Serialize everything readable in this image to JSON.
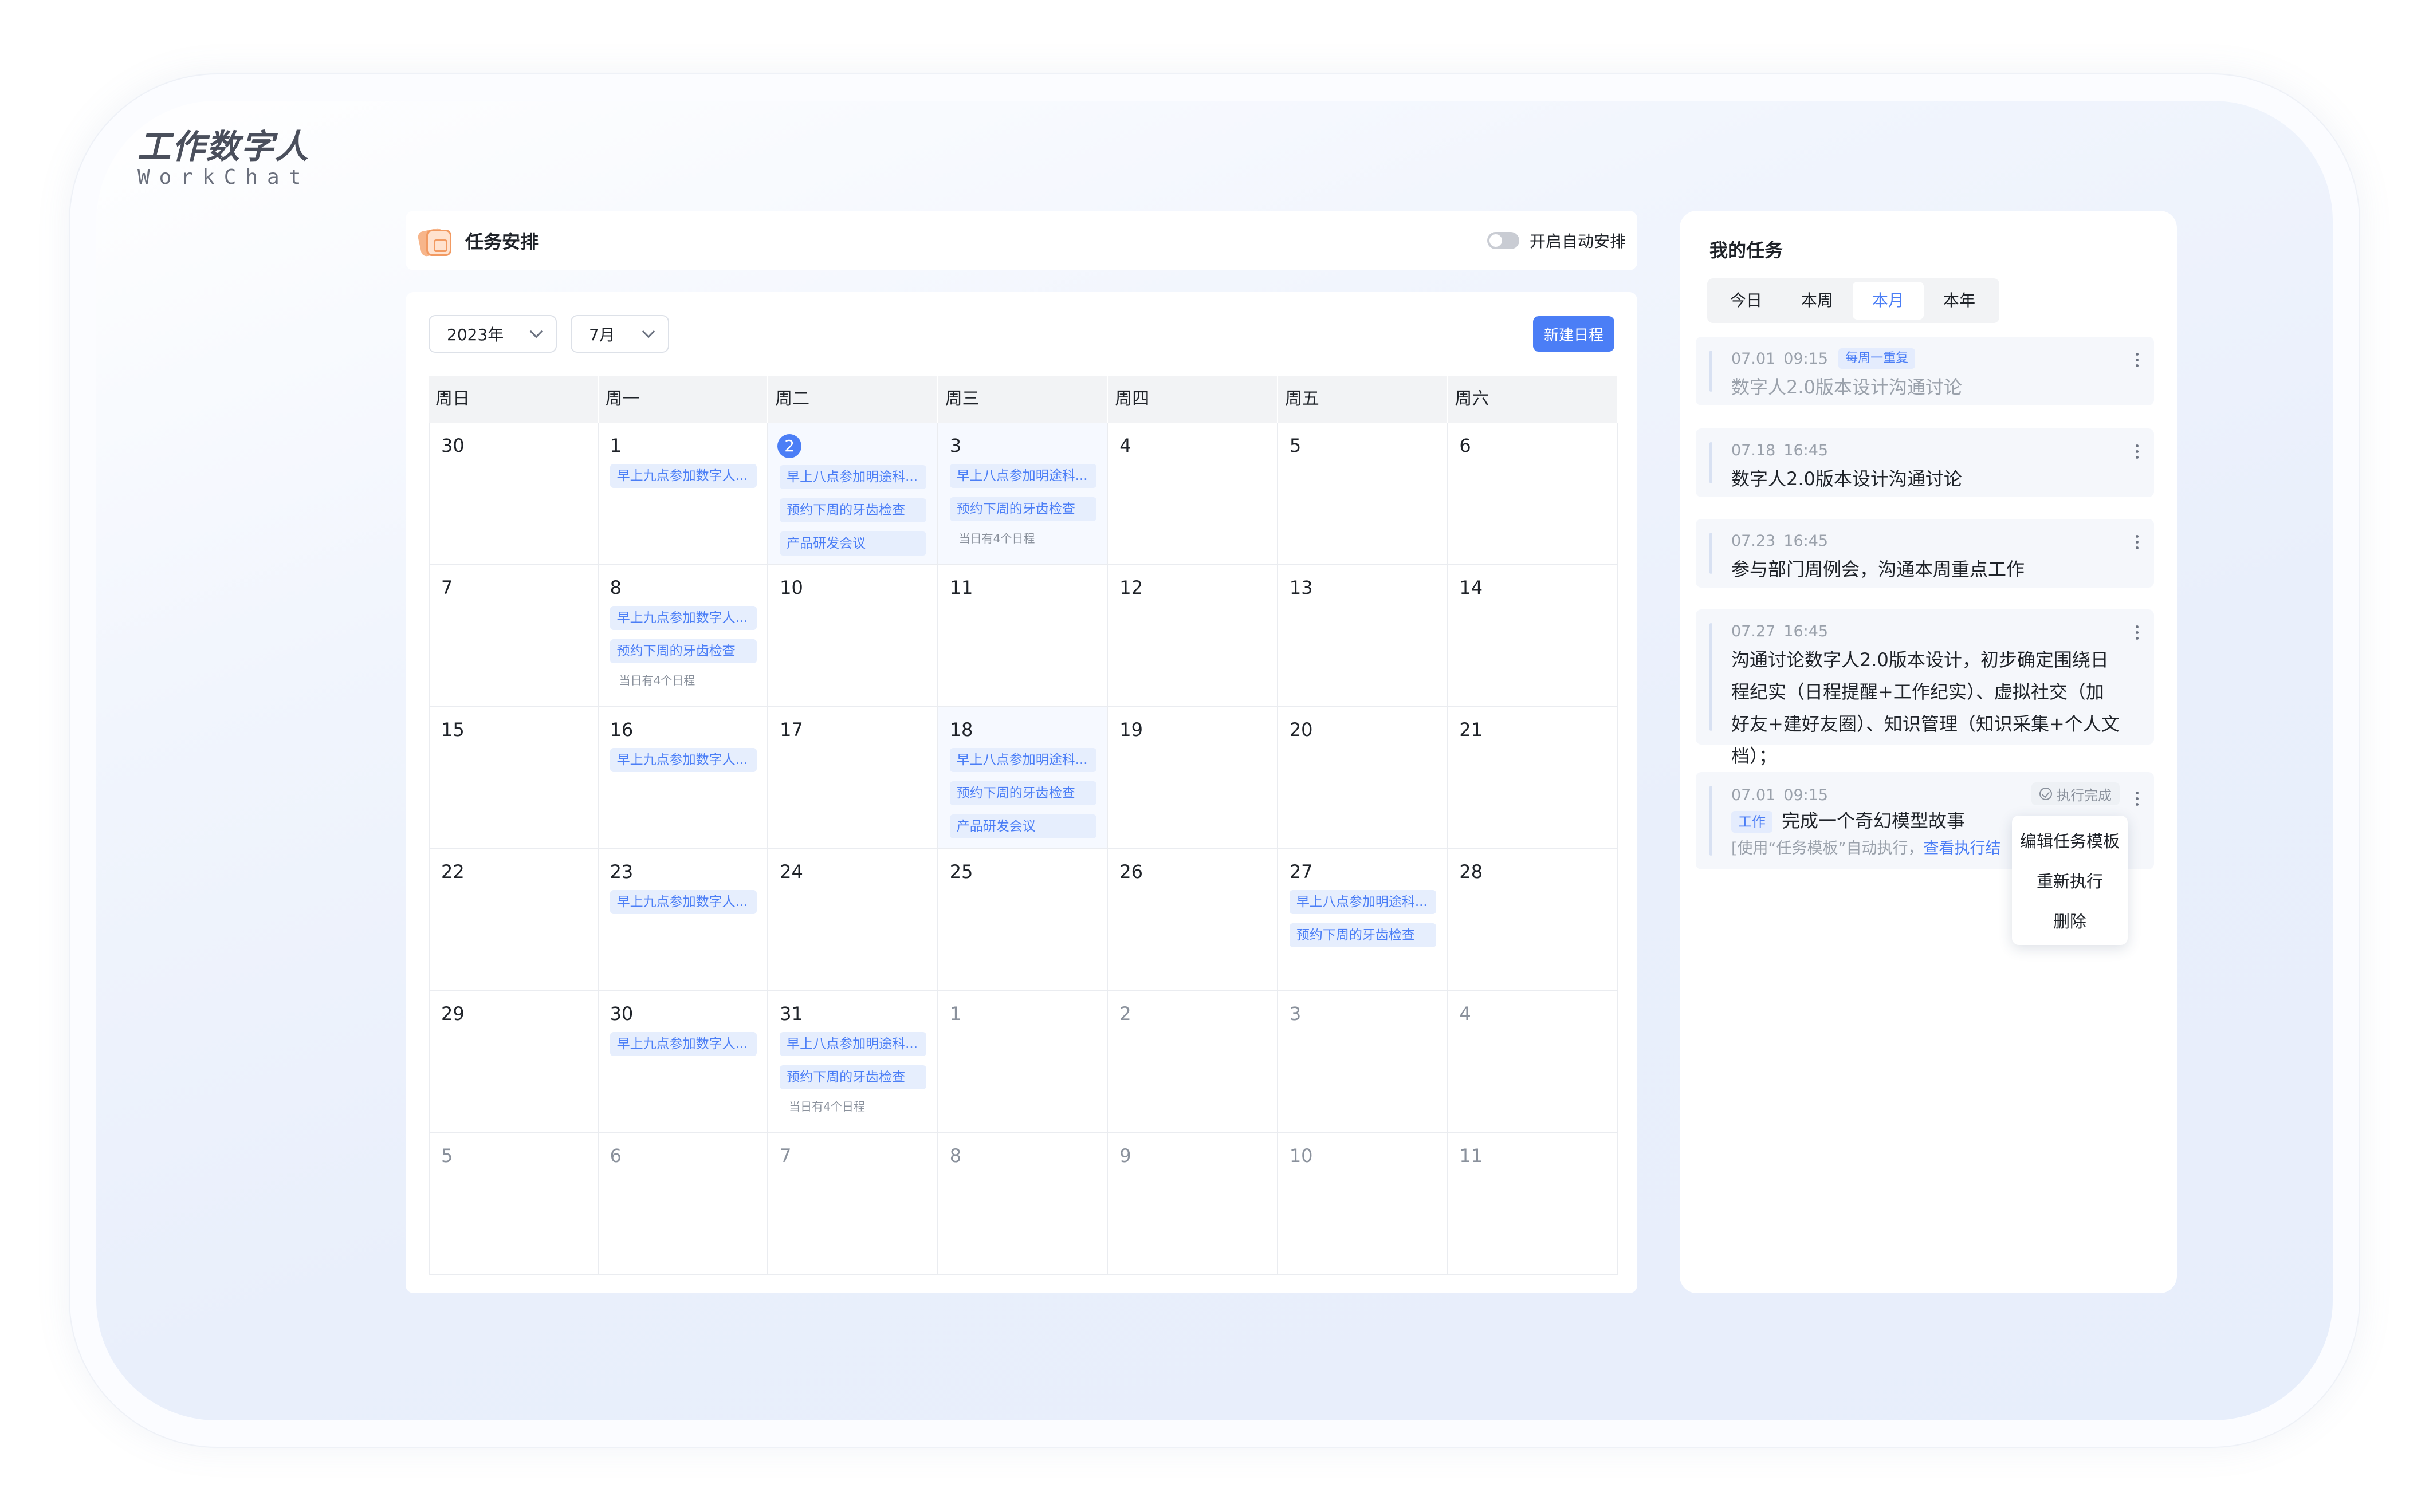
{
  "brand": {
    "name_cn": "工作数字人",
    "name_en": "WorkChat"
  },
  "header": {
    "title": "任务安排",
    "auto_toggle_label": "开启自动安排",
    "auto_toggle_on": false
  },
  "calendar": {
    "year": "2023年",
    "month": "7月",
    "new_button": "新建日程",
    "weekdays": [
      "周日",
      "周一",
      "周二",
      "周三",
      "周四",
      "周五",
      "周六"
    ],
    "weeks": [
      [
        {
          "d": "30",
          "dim": false,
          "events": []
        },
        {
          "d": "1",
          "dim": false,
          "events": [
            "早上九点参加数字人..."
          ]
        },
        {
          "d": "2",
          "dim": false,
          "today": true,
          "hl": true,
          "events": [
            "早上八点参加明途科...",
            "预约下周的牙齿检查",
            "产品研发会议"
          ]
        },
        {
          "d": "3",
          "dim": false,
          "hl": true,
          "events": [
            "早上八点参加明途科...",
            "预约下周的牙齿检查"
          ],
          "more": "当日有4个日程"
        },
        {
          "d": "4",
          "dim": false,
          "events": []
        },
        {
          "d": "5",
          "dim": false,
          "events": []
        },
        {
          "d": "6",
          "dim": false,
          "events": []
        }
      ],
      [
        {
          "d": "7",
          "dim": false,
          "events": []
        },
        {
          "d": "8",
          "dim": false,
          "events": [
            "早上九点参加数字人...",
            "预约下周的牙齿检查"
          ],
          "more": "当日有4个日程"
        },
        {
          "d": "10",
          "dim": false,
          "events": []
        },
        {
          "d": "11",
          "dim": false,
          "events": []
        },
        {
          "d": "12",
          "dim": false,
          "events": []
        },
        {
          "d": "13",
          "dim": false,
          "events": []
        },
        {
          "d": "14",
          "dim": false,
          "events": []
        }
      ],
      [
        {
          "d": "15",
          "dim": false,
          "events": []
        },
        {
          "d": "16",
          "dim": false,
          "events": [
            "早上九点参加数字人..."
          ]
        },
        {
          "d": "17",
          "dim": false,
          "events": []
        },
        {
          "d": "18",
          "dim": false,
          "hl": true,
          "events": [
            "早上八点参加明途科...",
            "预约下周的牙齿检查",
            "产品研发会议"
          ]
        },
        {
          "d": "19",
          "dim": false,
          "events": []
        },
        {
          "d": "20",
          "dim": false,
          "events": []
        },
        {
          "d": "21",
          "dim": false,
          "events": []
        }
      ],
      [
        {
          "d": "22",
          "dim": false,
          "events": []
        },
        {
          "d": "23",
          "dim": false,
          "events": [
            "早上九点参加数字人..."
          ]
        },
        {
          "d": "24",
          "dim": false,
          "events": []
        },
        {
          "d": "25",
          "dim": false,
          "events": []
        },
        {
          "d": "26",
          "dim": false,
          "events": []
        },
        {
          "d": "27",
          "dim": false,
          "events": [
            "早上八点参加明途科...",
            "预约下周的牙齿检查"
          ]
        },
        {
          "d": "28",
          "dim": false,
          "events": []
        }
      ],
      [
        {
          "d": "29",
          "dim": false,
          "events": []
        },
        {
          "d": "30",
          "dim": false,
          "events": [
            "早上九点参加数字人..."
          ]
        },
        {
          "d": "31",
          "dim": false,
          "events": [
            "早上八点参加明途科...",
            "预约下周的牙齿检查"
          ],
          "more": "当日有4个日程"
        },
        {
          "d": "1",
          "dim": true,
          "events": []
        },
        {
          "d": "2",
          "dim": true,
          "events": []
        },
        {
          "d": "3",
          "dim": true,
          "events": []
        },
        {
          "d": "4",
          "dim": true,
          "events": []
        }
      ],
      [
        {
          "d": "5",
          "dim": true,
          "events": []
        },
        {
          "d": "6",
          "dim": true,
          "events": []
        },
        {
          "d": "7",
          "dim": true,
          "events": []
        },
        {
          "d": "8",
          "dim": true,
          "events": []
        },
        {
          "d": "9",
          "dim": true,
          "events": []
        },
        {
          "d": "10",
          "dim": true,
          "events": []
        },
        {
          "d": "11",
          "dim": true,
          "events": []
        }
      ]
    ]
  },
  "tasks_panel": {
    "title": "我的任务",
    "tabs": [
      "今日",
      "本周",
      "本月",
      "本年"
    ],
    "active_tab": "本月",
    "tasks": [
      {
        "date": "07.01",
        "time": "09:15",
        "badge": "每周一重复",
        "text": "数字人2.0版本设计沟通讨论",
        "muted": true
      },
      {
        "date": "07.18",
        "time": "16:45",
        "text": "数字人2.0版本设计沟通讨论"
      },
      {
        "date": "07.23",
        "time": "16:45",
        "text": "参与部门周例会，沟通本周重点工作"
      },
      {
        "date": "07.27",
        "time": "16:45",
        "text": "沟通讨论数字人2.0版本设计，初步确定围绕日程纪实（日程提醒+工作纪实）、虚拟社交（加好友+建好友圈）、知识管理（知识采集+个人文档）；"
      }
    ],
    "auto_task": {
      "date": "07.01",
      "time": "09:15",
      "status": "执行完成",
      "tag": "工作",
      "text": "完成一个奇幻模型故事",
      "sub": "[使用“任务模板”自动执行，",
      "sub_link": "查看执行结"
    },
    "context_menu": [
      "编辑任务模板",
      "重新执行",
      "删除"
    ]
  }
}
